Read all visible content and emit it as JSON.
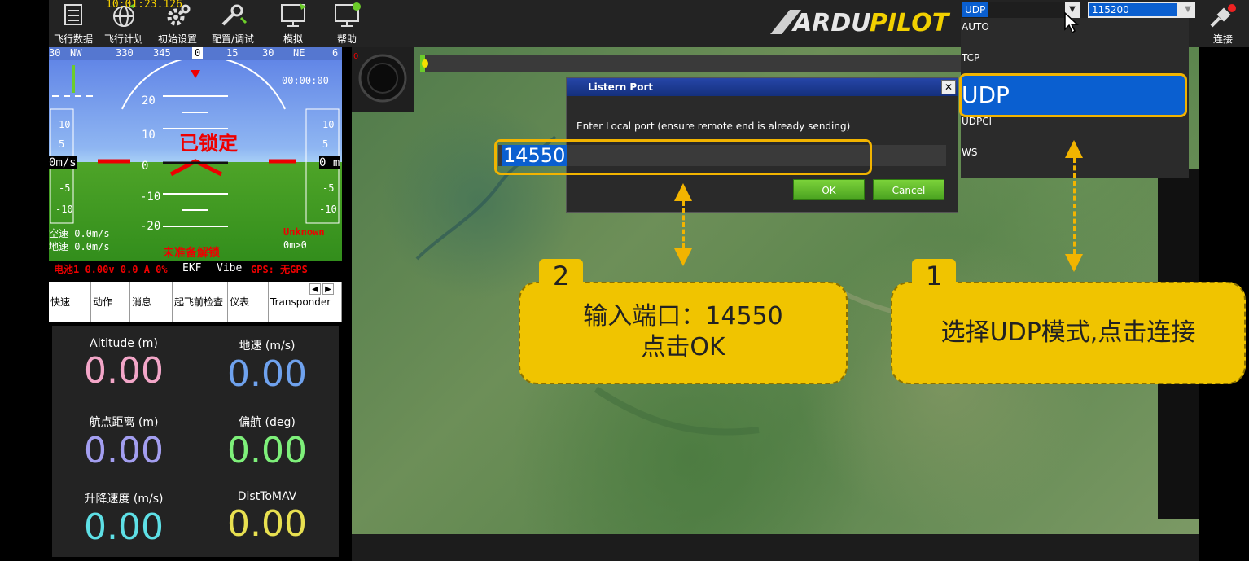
{
  "toolbar": {
    "clock": "10:01:23.126",
    "buttons": [
      {
        "label": "飞行数据",
        "icon": "flight-data-icon"
      },
      {
        "label": "飞行计划",
        "icon": "globe-icon"
      },
      {
        "label": "初始设置",
        "icon": "gear-icon"
      },
      {
        "label": "配置/调试",
        "icon": "wrench-icon"
      },
      {
        "label": "模拟",
        "icon": "monitor-icon"
      },
      {
        "label": "帮助",
        "icon": "help-monitor-icon"
      }
    ],
    "logo_text": "ARDUPILOT",
    "connection_type": "UDP",
    "baud_rate": "115200",
    "connect_label": "连接"
  },
  "hud": {
    "compass": [
      "30",
      "NW",
      "330",
      "345",
      "0",
      "15",
      "30",
      "NE",
      "6"
    ],
    "time": "00:00:00",
    "locked": "已锁定",
    "pitch_marks": [
      "20",
      "10",
      "0",
      "-10",
      "-20"
    ],
    "scale_left": [
      "10",
      "5",
      "0m/s",
      "-5",
      "-10"
    ],
    "scale_right": [
      "10",
      "5",
      "0 m",
      "-5",
      "-10"
    ],
    "airspeed": "空速 0.0m/s",
    "groundspeed": "地速 0.0m/s",
    "not_ready": "未准备解锁",
    "unknown": "Unknown",
    "distance": "0m>0",
    "battery": "电池1 0.00v 0.0 A 0%",
    "ekf": "EKF",
    "vibe": "Vibe",
    "gps": "GPS: 无GPS"
  },
  "tabs": [
    "快速",
    "动作",
    "消息",
    "起飞前检查",
    "仪表",
    "Transponder"
  ],
  "quick": [
    {
      "title": "Altitude (m)",
      "value": "0.00",
      "color": "#f3a6c8"
    },
    {
      "title": "地速 (m/s)",
      "value": "0.00",
      "color": "#6fa2ee"
    },
    {
      "title": "航点距离 (m)",
      "value": "0.00",
      "color": "#a39ef0"
    },
    {
      "title": "偏航 (deg)",
      "value": "0.00",
      "color": "#7ef07a"
    },
    {
      "title": "升降速度 (m/s)",
      "value": "0.00",
      "color": "#5ee0e6"
    },
    {
      "title": "DistToMAV",
      "value": "0.00",
      "color": "#e8e050"
    }
  ],
  "map": {
    "progress_label": "0"
  },
  "dialog": {
    "title": "Listern Port",
    "message": "Enter Local port (ensure remote end is already sending)",
    "port_value": "14550",
    "ok_label": "OK",
    "cancel_label": "Cancel"
  },
  "dropdown": {
    "items": [
      "AUTO",
      "TCP",
      "UDP",
      "UDPCl",
      "WS"
    ]
  },
  "annotations": {
    "step1_number": "1",
    "step1_text": "选择UDP模式,点击连接",
    "step2_number": "2",
    "step2_line1": "输入端口：14550",
    "step2_line2": "点击OK"
  },
  "colors": {
    "accent_yellow": "#f0c400",
    "selection_blue": "#0a5fd0",
    "hud_red": "#e00000"
  }
}
